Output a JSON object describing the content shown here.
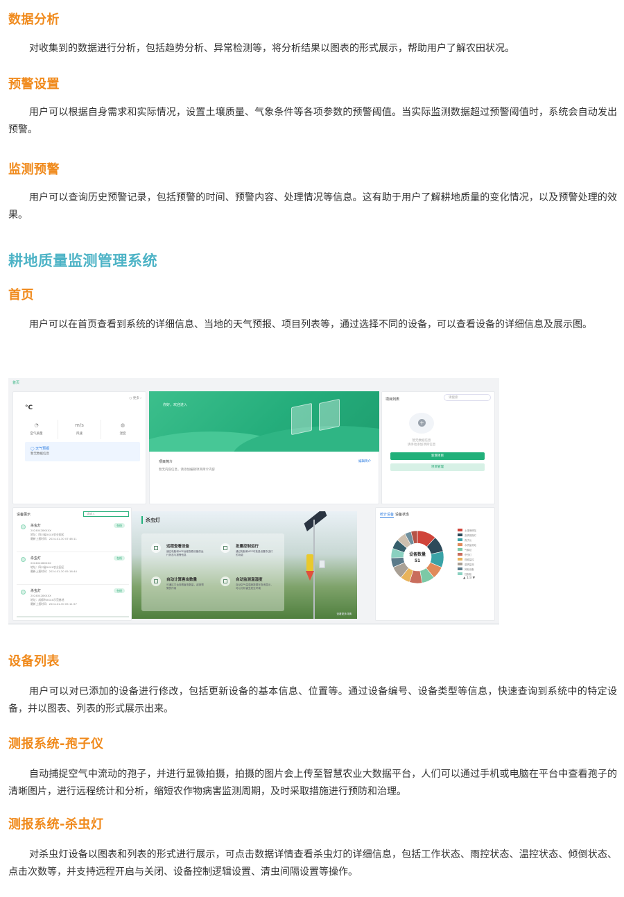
{
  "sections": [
    {
      "heading": "数据分析",
      "text": "对收集到的数据进行分析，包括趋势分析、异常检测等，将分析结果以图表的形式展示，帮助用户了解农田状况。"
    },
    {
      "heading": "预警设置",
      "text": "用户可以根据自身需求和实际情况，设置土壤质量、气象条件等各项参数的预警阈值。当实际监测数据超过预警阈值时，系统会自动发出预警。"
    },
    {
      "heading": "监测预警",
      "text": "用户可以查询历史预警记录，包括预警的时间、预警内容、处理情况等信息。这有助于用户了解耕地质量的变化情况，以及预警处理的效果。"
    }
  ],
  "system_title": "耕地质量监测管理系统",
  "home": {
    "heading": "首页",
    "text": "用户可以在首页查看到系统的详细信息、当地的天气预报、项目列表等，通过选择不同的设备，可以查看设备的详细信息及展示图。"
  },
  "sections2": [
    {
      "heading": "设备列表",
      "text": "用户可以对已添加的设备进行修改，包括更新设备的基本信息、位置等。通过设备编号、设备类型等信息，快速查询到系统中的特定设备，并以图表、列表的形式展示出来。"
    },
    {
      "heading": "测报系统-孢子仪",
      "text": "自动捕捉空气中流动的孢子，并进行显微拍摄，拍摄的图片会上传至智慧农业大数据平台，人们可以通过手机或电脑在平台中查看孢子的清晰图片，进行远程统计和分析，缩短农作物病害监测周期，及时采取措施进行预防和治理。"
    },
    {
      "heading": "测报系统-杀虫灯",
      "text": "对杀虫灯设备以图表和列表的形式进行展示，可点击数据详情查看杀虫灯的详细信息，包括工作状态、雨控状态、温控状态、倾倒状态、点击次数等，并支持远程开启与关闭、设备控制逻辑设置、清虫间隔设置等操作。"
    }
  ],
  "screenshot": {
    "crumb": "首页",
    "weather": {
      "temp": "°C",
      "more": "○ 更多 ›",
      "cols": [
        {
          "icon": "◔",
          "label": "空气质量"
        },
        {
          "icon": "m/s",
          "label": "风速"
        },
        {
          "icon": "◍",
          "label": "湿度"
        }
      ],
      "forecast_title": "◯ 天气预报",
      "forecast_sub": "暂无数据信息"
    },
    "banner_title": "你好，欢迎进入",
    "project": {
      "head": "项目简介",
      "more": "编辑简介",
      "empty": "暂无内容信息，请添加编辑项目简介内容"
    },
    "plist": {
      "title": "项目列表",
      "search": "请搜索",
      "empty1": "暂无数据信息",
      "empty2": "请手动添加项目信息",
      "btn_new": "新增项目",
      "btn_manage": "项目管理"
    },
    "devices": {
      "title": "设备展示",
      "search": "请输入",
      "items": [
        {
          "name": "杀虫灯",
          "id": "20240428XXXX",
          "addr": "地址：四川省XXXX农业园区",
          "time": "最新上报时间：2024-01-30 07:46:11",
          "tag": "在线"
        },
        {
          "name": "杀虫灯",
          "id": "20240428XXXX",
          "addr": "地址：四川省XXXX农业园区",
          "time": "最新上报时间：2024-01-30 05:16:44",
          "tag": "在线"
        },
        {
          "name": "杀虫灯",
          "id": "20240428XXXX",
          "addr": "地址：成都市XXXX示范基地",
          "time": "最新上报时间：2024-01-30 05:11:57",
          "tag": "在线"
        }
      ]
    },
    "lamp": {
      "title": "杀虫灯",
      "features": [
        {
          "title": "远程查看设备",
          "desc": "通过电脑和APP远程查看设备的运行状态与报警信息"
        },
        {
          "title": "批量控制运行",
          "desc": "通过电脑和APP可批量设置杀虫灯的功能"
        },
        {
          "title": "自动计算害虫数量",
          "desc": "可通过平台查看害虫数量，起到预警的作用"
        },
        {
          "title": "自动监测温湿度",
          "desc": "自动空气温湿度数据在查询显示，可以分析害虫发生环境"
        }
      ],
      "footer": "查看更多详情"
    },
    "stats": {
      "tab1": "统计设备",
      "tab2": "设备状态",
      "center_label": "设备数量",
      "center_value": "51",
      "legend": [
        "土壤墒情站",
        "虫情测报灯",
        "孢子仪",
        "水质监测站",
        "气象站",
        "杀虫灯",
        "视频监控",
        "苗情监测",
        "其他设备",
        "控制柜"
      ],
      "page": "▲ 1/3 ▼"
    }
  },
  "chart_data": {
    "type": "pie",
    "title": "设备数量",
    "total": 51,
    "colors": [
      "#d0443a",
      "#2d4a5a",
      "#3aa3a7",
      "#e08a5a",
      "#7cc9a6",
      "#c96d5c",
      "#e8b35a",
      "#a9a095",
      "#5b7a8a",
      "#8ad0c0",
      "#355e6b",
      "#cdbfae",
      "#6f8f9c",
      "#b55347"
    ],
    "values": [
      6,
      5,
      5,
      4,
      4,
      4,
      3,
      4,
      3,
      3,
      3,
      3,
      2,
      2
    ]
  }
}
